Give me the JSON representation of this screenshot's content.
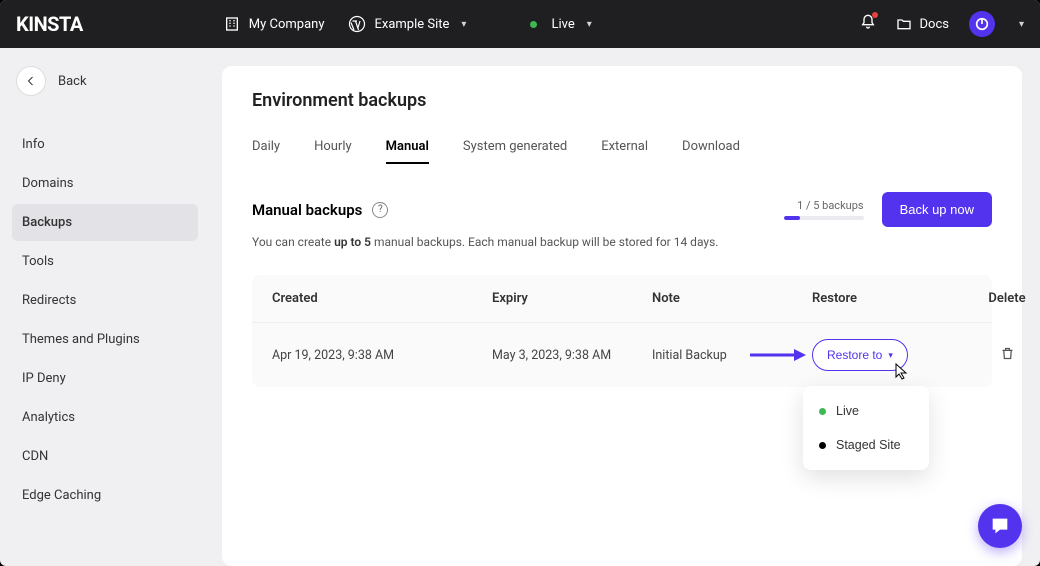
{
  "topbar": {
    "logo": "KINSTA",
    "company": "My Company",
    "site": "Example Site",
    "env": "Live",
    "docs": "Docs"
  },
  "back_label": "Back",
  "sidebar": {
    "items": [
      {
        "label": "Info"
      },
      {
        "label": "Domains"
      },
      {
        "label": "Backups"
      },
      {
        "label": "Tools"
      },
      {
        "label": "Redirects"
      },
      {
        "label": "Themes and Plugins"
      },
      {
        "label": "IP Deny"
      },
      {
        "label": "Analytics"
      },
      {
        "label": "CDN"
      },
      {
        "label": "Edge Caching"
      }
    ]
  },
  "page_title": "Environment backups",
  "tabs": [
    {
      "label": "Daily"
    },
    {
      "label": "Hourly"
    },
    {
      "label": "Manual"
    },
    {
      "label": "System generated"
    },
    {
      "label": "External"
    },
    {
      "label": "Download"
    }
  ],
  "section": {
    "title": "Manual backups",
    "progress_label": "1 / 5 backups",
    "backup_btn": "Back up now",
    "desc_prefix": "You can create ",
    "desc_bold": "up to 5",
    "desc_suffix": " manual backups. Each manual backup will be stored for 14 days."
  },
  "table": {
    "headers": {
      "created": "Created",
      "expiry": "Expiry",
      "note": "Note",
      "restore": "Restore",
      "delete": "Delete"
    },
    "row": {
      "created": "Apr 19, 2023, 9:38 AM",
      "expiry": "May 3, 2023, 9:38 AM",
      "note": "Initial Backup",
      "restore_btn": "Restore to"
    }
  },
  "dropdown": {
    "live": "Live",
    "staged": "Staged Site"
  }
}
